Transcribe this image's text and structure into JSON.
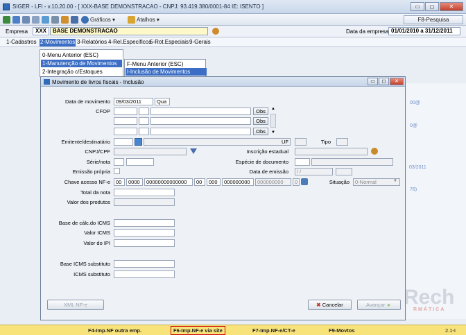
{
  "window": {
    "title": "SIGER - LFI - v.10.20.00 - [ XXX-BASE DEMONSTRACAO - CNPJ: 93.419.380/0001-84 IE: ISENTO ]",
    "btn_min": "▭",
    "btn_max": "◻",
    "btn_close": "✕"
  },
  "toolbar": {
    "graficos": "Gráficos ▾",
    "atalhos": "Atalhos ▾",
    "f8": "F8-Pesquisa"
  },
  "company": {
    "label": "Empresa",
    "code": "XXX",
    "name": "BASE DEMONSTRACAO",
    "date_label": "Data da empresa",
    "date_range": "01/01/2010 a 31/12/2011"
  },
  "menu": [
    "1-Cadastros",
    "2-Movimentos",
    "3-Relatórios",
    "4-Rel.Específicos",
    "5-Rot.Especiais",
    "9-Gerais"
  ],
  "dropdown1": [
    "0-Menu Anterior (ESC)",
    "1-Manutenção de Movimentos",
    "2-Integração c/Estoques"
  ],
  "dropdown2": [
    "F-Menu Anterior (ESC)",
    "I-Inclusão de Movimentos"
  ],
  "side_links": [
    "00@",
    "0@",
    "03/2011",
    "76)"
  ],
  "watermark": {
    "big": "Rech",
    "small": "RMÁTICA"
  },
  "dialog": {
    "title": "Movimento de livros fiscais - Inclusão",
    "labels": {
      "data_mov": "Data de movimento",
      "cfop": "CFOP",
      "emitente": "Emitente/destinatário",
      "uf": "UF",
      "tipo": "Tipo",
      "cnpj": "CNPJ/CPF",
      "ie": "Inscrição estadual",
      "serie": "Série/nota",
      "especie": "Espécie de documento",
      "emissao_propria": "Emissão própria",
      "data_emissao": "Data de emissão",
      "chave": "Chave acesso NF-e",
      "situacao": "Situação",
      "total_nota": "Total da nota",
      "valor_produtos": "Valor dos produtos",
      "base_icms": "Base de cálc.do ICMS",
      "valor_icms": "Valor ICMS",
      "valor_ipi": "Valor do IPI",
      "base_icms_st": "Base ICMS substituto",
      "icms_st": "ICMS substituto"
    },
    "values": {
      "data_mov": "09/03/2011",
      "dia": "Qua",
      "obs": "Obs",
      "data_emissao": "/ /",
      "situacao": "0-Normal",
      "chave": [
        "00",
        "0000",
        "00000000000000",
        "00",
        "000",
        "000000000",
        "000000000",
        "0"
      ]
    },
    "buttons": {
      "xml": "XML NF-e",
      "cancelar": "Cancelar",
      "avancar": "Avançar"
    }
  },
  "status": [
    "F4-Imp.NF outra emp.",
    "F6-Imp.NF-e via site",
    "F7-Imp.NF-e/CT-e",
    "F9-Movtos",
    "2.1-I"
  ]
}
